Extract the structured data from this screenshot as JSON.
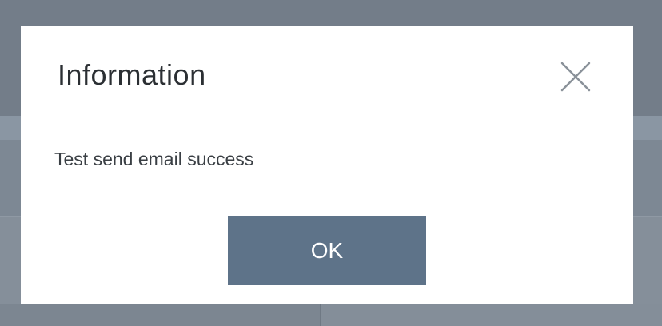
{
  "dialog": {
    "title": "Information",
    "close_icon": "close-icon",
    "message": "Test send email success",
    "ok_label": "OK"
  },
  "colors": {
    "overlay": "#7f8a96",
    "dialog_background": "#ffffff",
    "title_text": "#2b2f33",
    "message_text": "#3a3f44",
    "close_icon": "#8a9199",
    "ok_button": "#5e7389",
    "ok_button_text": "#ffffff"
  }
}
